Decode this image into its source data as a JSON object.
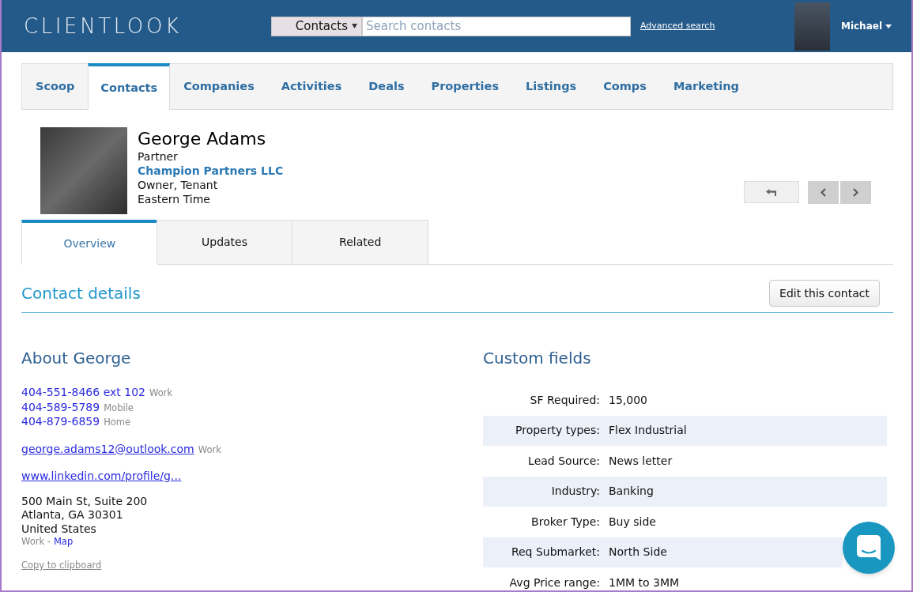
{
  "header": {
    "logo": "CLIENTLOOK",
    "search": {
      "scope": "Contacts",
      "placeholder": "Search contacts"
    },
    "advanced_search": "Advanced search",
    "user": {
      "name": "Michael"
    }
  },
  "nav_tabs": [
    {
      "label": "Scoop",
      "selected": false
    },
    {
      "label": "Contacts",
      "selected": true
    },
    {
      "label": "Companies",
      "selected": false
    },
    {
      "label": "Activities",
      "selected": false
    },
    {
      "label": "Deals",
      "selected": false
    },
    {
      "label": "Properties",
      "selected": false
    },
    {
      "label": "Listings",
      "selected": false
    },
    {
      "label": "Comps",
      "selected": false
    },
    {
      "label": "Marketing",
      "selected": false
    }
  ],
  "contact": {
    "name": "George Adams",
    "title": "Partner",
    "company": "Champion Partners LLC",
    "roles": "Owner, Tenant",
    "timezone": "Eastern Time"
  },
  "subtabs": [
    {
      "label": "Overview",
      "selected": true
    },
    {
      "label": "Updates",
      "selected": false
    },
    {
      "label": "Related",
      "selected": false
    }
  ],
  "section": {
    "title": "Contact details",
    "edit_button": "Edit this contact"
  },
  "about": {
    "title": "About George",
    "phones": [
      {
        "number": "404-551-8466 ext 102",
        "type": "Work"
      },
      {
        "number": "404-589-5789",
        "type": "Mobile"
      },
      {
        "number": "404-879-6859",
        "type": "Home"
      }
    ],
    "emails": [
      {
        "address": "george.adams12@outlook.com",
        "type": "Work"
      }
    ],
    "website": "www.linkedin.com/profile/g...",
    "address": {
      "lines": [
        "500 Main St, Suite 200",
        "Atlanta, GA 30301",
        "United States"
      ],
      "label": "Work -",
      "map_link": "Map"
    },
    "copy_link": "Copy to clipboard"
  },
  "custom_fields": {
    "title": "Custom fields",
    "rows": [
      {
        "label": "SF Required:",
        "value": "15,000"
      },
      {
        "label": "Property types:",
        "value": "Flex Industrial"
      },
      {
        "label": "Lead Source:",
        "value": "News letter"
      },
      {
        "label": "Industry:",
        "value": "Banking"
      },
      {
        "label": "Broker Type:",
        "value": "Buy side"
      },
      {
        "label": "Req Submarket:",
        "value": "North Side"
      },
      {
        "label": "Avg Price range:",
        "value": "1MM to 3MM"
      }
    ]
  }
}
